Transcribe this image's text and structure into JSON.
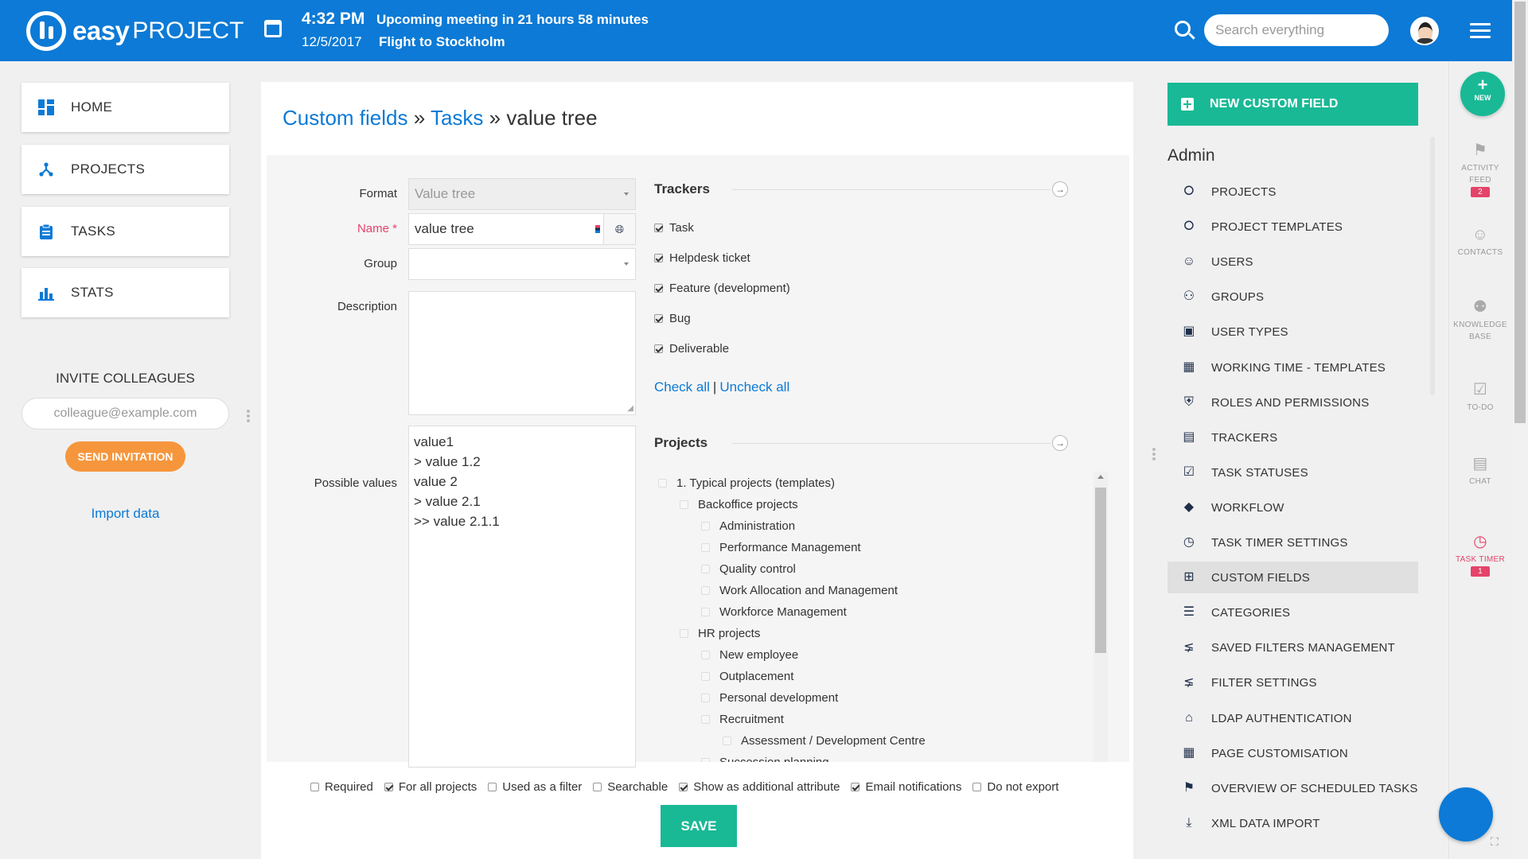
{
  "header": {
    "logo_text": "easy",
    "logo_text2": "PROJECT",
    "meeting_time": "4:32 PM",
    "meeting_date": "12/5/2017",
    "meeting_title": "Upcoming meeting in 21 hours 58 minutes",
    "meeting_subject": "Flight to Stockholm",
    "search_placeholder": "Search everything"
  },
  "sidebar": {
    "items": [
      {
        "label": "HOME",
        "icon": "dashboard-icon"
      },
      {
        "label": "PROJECTS",
        "icon": "projects-icon"
      },
      {
        "label": "TASKS",
        "icon": "clipboard-icon"
      },
      {
        "label": "STATS",
        "icon": "bar-chart-icon"
      }
    ],
    "invite_title": "INVITE COLLEAGUES",
    "invite_placeholder": "colleague@example.com",
    "invite_button": "SEND INVITATION",
    "import_link": "Import data"
  },
  "main": {
    "breadcrumb": {
      "level1": "Custom fields",
      "sep": "»",
      "level2": "Tasks",
      "current": "value tree"
    },
    "form": {
      "format_label": "Format",
      "format_value": "Value tree",
      "name_label": "Name",
      "name_required": "*",
      "name_value": "value tree",
      "group_label": "Group",
      "group_value": "",
      "description_label": "Description",
      "description_value": "",
      "possible_values_label": "Possible values",
      "possible_values": [
        "value1",
        "> value 1.2",
        "value 2",
        "> value 2.1",
        ">> value 2.1.1"
      ]
    },
    "trackers": {
      "title": "Trackers",
      "items": [
        {
          "label": "Task",
          "checked": true
        },
        {
          "label": "Helpdesk ticket",
          "checked": true
        },
        {
          "label": "Feature (development)",
          "checked": true
        },
        {
          "label": "Bug",
          "checked": true
        },
        {
          "label": "Deliverable",
          "checked": true
        }
      ],
      "check_all": "Check all",
      "separator": "|",
      "uncheck_all": "Uncheck all"
    },
    "projects": {
      "title": "Projects",
      "items": [
        {
          "label": "1. Typical projects (templates)",
          "level": 0
        },
        {
          "label": "Backoffice projects",
          "level": 1
        },
        {
          "label": "Administration",
          "level": 2
        },
        {
          "label": "Performance Management",
          "level": 2
        },
        {
          "label": "Quality control",
          "level": 2
        },
        {
          "label": "Work Allocation and Management",
          "level": 2
        },
        {
          "label": "Workforce Management",
          "level": 2
        },
        {
          "label": "HR projects",
          "level": 1
        },
        {
          "label": "New employee",
          "level": 2
        },
        {
          "label": "Outplacement",
          "level": 2
        },
        {
          "label": "Personal development",
          "level": 2
        },
        {
          "label": "Recruitment",
          "level": 2
        },
        {
          "label": "Assessment / Development Centre",
          "level": 3
        },
        {
          "label": "Succession planning",
          "level": 2
        }
      ]
    },
    "options": [
      {
        "label": "Required",
        "checked": false
      },
      {
        "label": "For all projects",
        "checked": true
      },
      {
        "label": "Used as a filter",
        "checked": false
      },
      {
        "label": "Searchable",
        "checked": false
      },
      {
        "label": "Show as additional attribute",
        "checked": true
      },
      {
        "label": "Email notifications",
        "checked": true
      },
      {
        "label": "Do not export",
        "checked": false
      }
    ],
    "save_button": "SAVE"
  },
  "admin": {
    "new_button": "NEW CUSTOM FIELD",
    "title": "Admin",
    "items": [
      {
        "label": "PROJECTS",
        "icon": "projects-icon"
      },
      {
        "label": "PROJECT TEMPLATES",
        "icon": "project-templates-icon"
      },
      {
        "label": "USERS",
        "icon": "user-icon"
      },
      {
        "label": "GROUPS",
        "icon": "groups-icon"
      },
      {
        "label": "USER TYPES",
        "icon": "id-badge-icon"
      },
      {
        "label": "WORKING TIME - TEMPLATES",
        "icon": "calendar-icon"
      },
      {
        "label": "ROLES AND PERMISSIONS",
        "icon": "shield-icon"
      },
      {
        "label": "TRACKERS",
        "icon": "clipboard-icon"
      },
      {
        "label": "TASK STATUSES",
        "icon": "checkbox-icon"
      },
      {
        "label": "WORKFLOW",
        "icon": "diamond-arrow-icon"
      },
      {
        "label": "TASK TIMER SETTINGS",
        "icon": "alarm-icon"
      },
      {
        "label": "CUSTOM FIELDS",
        "icon": "plus-square-icon"
      },
      {
        "label": "CATEGORIES",
        "icon": "list-icon"
      },
      {
        "label": "SAVED FILTERS MANAGEMENT",
        "icon": "filter-icon"
      },
      {
        "label": "FILTER SETTINGS",
        "icon": "filter-icon"
      },
      {
        "label": "LDAP AUTHENTICATION",
        "icon": "ldap-icon"
      },
      {
        "label": "PAGE CUSTOMISATION",
        "icon": "dashboard-icon"
      },
      {
        "label": "OVERVIEW OF SCHEDULED TASKS",
        "icon": "flag-icon"
      },
      {
        "label": "XML DATA IMPORT",
        "icon": "download-icon"
      }
    ],
    "active_item": "CUSTOM FIELDS"
  },
  "rail": {
    "new_label": "NEW",
    "activity_feed": "ACTIVITY FEED",
    "activity_badge": "2",
    "contacts": "CONTACTS",
    "knowledge_base": "KNOWLEDGE BASE",
    "todo": "TO-DO",
    "chat": "CHAT",
    "task_timer": "TASK TIMER",
    "task_timer_badge": "1"
  },
  "colors": {
    "brand_blue": "#0c7ad6",
    "accent_green": "#19b996",
    "invite_orange": "#f6963c",
    "required_red": "#e5436a"
  }
}
